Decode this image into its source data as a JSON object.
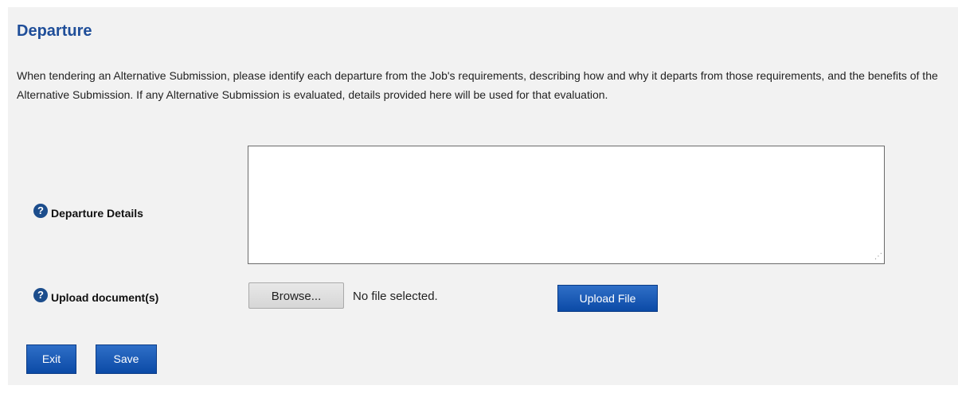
{
  "section": {
    "title": "Departure",
    "description": "When tendering an Alternative Submission, please identify each departure from the Job's requirements, describing how and why it departs from those requirements, and the benefits of the Alternative Submission. If any Alternative Submission is evaluated, details provided here will be used for that evaluation."
  },
  "fields": {
    "departure_details": {
      "label": "Departure Details",
      "value": ""
    },
    "upload": {
      "label": "Upload document(s)",
      "browse_label": "Browse...",
      "file_status": "No file selected.",
      "upload_button_label": "Upload File"
    }
  },
  "actions": {
    "exit_label": "Exit",
    "save_label": "Save"
  },
  "icons": {
    "help": "question-circle-icon",
    "resize": "resize-grip-icon"
  },
  "colors": {
    "title": "#1f4e99",
    "button": "#0b4aa6",
    "panel_background": "#f2f2f2"
  }
}
